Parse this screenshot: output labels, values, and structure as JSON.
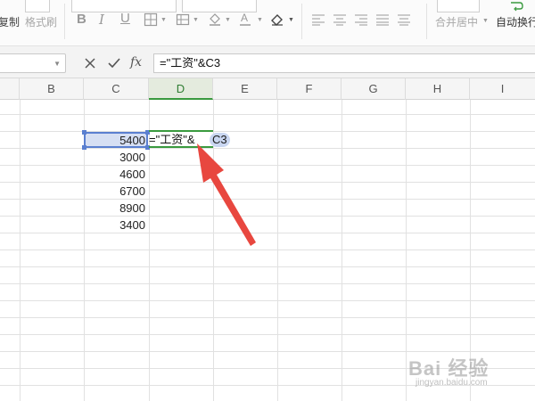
{
  "ribbon": {
    "copy_label": "复制",
    "format_painter_label": "格式刷",
    "merge_center_label": "合并居中",
    "auto_wrap_label": "自动换行",
    "bold_glyph": "B",
    "italic_glyph": "I",
    "underline_glyph": "U"
  },
  "formula_bar": {
    "fx_label": "fx",
    "formula": "=\"工资\"&C3"
  },
  "columns": [
    "B",
    "C",
    "D",
    "E",
    "F",
    "G",
    "H",
    "I"
  ],
  "active_column": "D",
  "cells": {
    "c3": "5400",
    "c4": "3000",
    "c5": "4600",
    "c6": "6700",
    "c7": "8900",
    "c8": "3400",
    "d3_formula_prefix": "=\"工资\"&",
    "d3_ref": "C3"
  },
  "colors": {
    "accent_green": "#3a9a3f",
    "selection_blue": "#5a7fd0",
    "arrow_red": "#e8473f"
  },
  "watermark": {
    "text": "Bai 经验",
    "sub": "jingyan.baidu.com"
  }
}
